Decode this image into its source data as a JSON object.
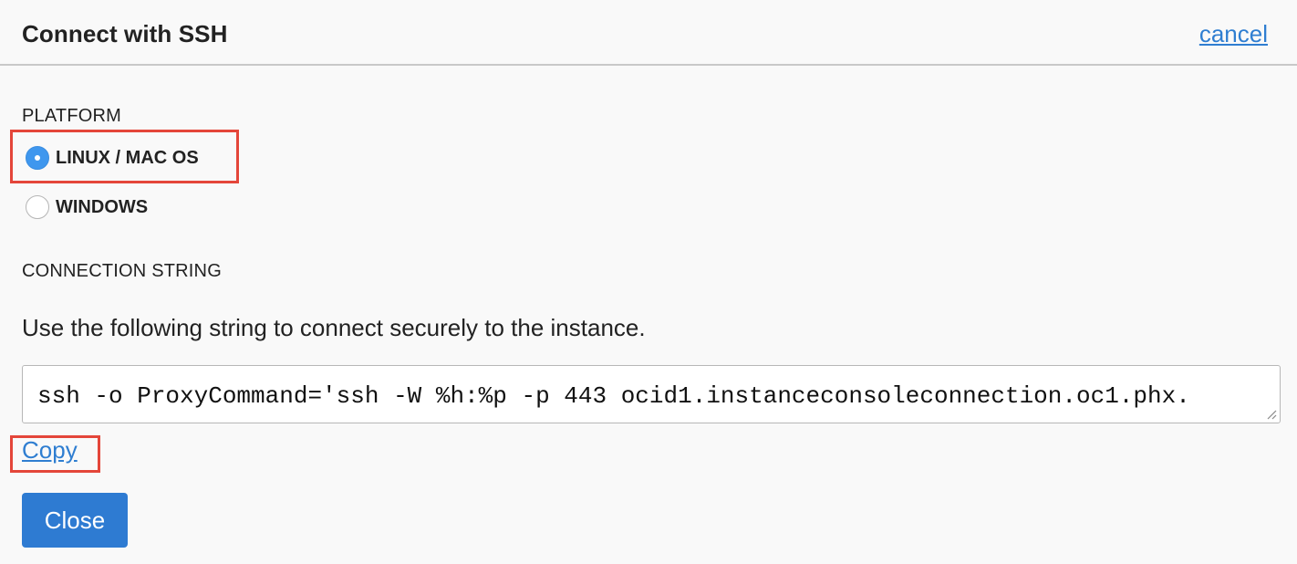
{
  "dialog": {
    "title": "Connect with SSH",
    "cancel_label": "cancel"
  },
  "platform": {
    "label": "PLATFORM",
    "options": [
      {
        "label": "LINUX / MAC OS",
        "selected": true
      },
      {
        "label": "WINDOWS",
        "selected": false
      }
    ]
  },
  "connection": {
    "label": "CONNECTION STRING",
    "help_text": "Use the following string to connect securely to the instance.",
    "value": "ssh -o ProxyCommand='ssh -W %h:%p -p 443 ocid1.instanceconsoleconnection.oc1.phx.",
    "copy_label": "Copy"
  },
  "footer": {
    "close_label": "Close"
  },
  "colors": {
    "link": "#2f7ed1",
    "primary_button": "#2e7bd2",
    "radio_selected": "#3f97ee",
    "highlight": "#e4463a"
  }
}
